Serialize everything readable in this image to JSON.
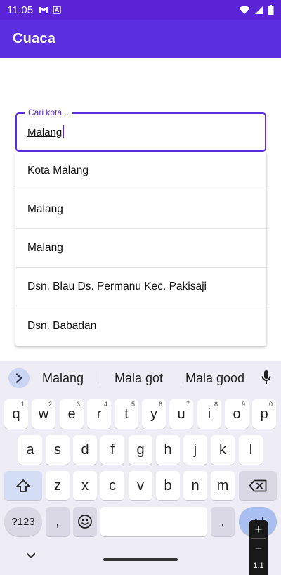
{
  "status_bar": {
    "time": "11:05"
  },
  "app": {
    "title": "Cuaca"
  },
  "search": {
    "label": "Cari kota...",
    "value": "Malang"
  },
  "suggestions": [
    "Kota Malang",
    "Malang",
    "Malang",
    "Dsn. Blau Ds. Permanu Kec. Pakisaji",
    "Dsn. Babadan"
  ],
  "keyboard": {
    "word_suggestions": [
      "Malang",
      "Mala got",
      "Mala good"
    ],
    "row1": [
      {
        "k": "q",
        "h": "1"
      },
      {
        "k": "w",
        "h": "2"
      },
      {
        "k": "e",
        "h": "3"
      },
      {
        "k": "r",
        "h": "4"
      },
      {
        "k": "t",
        "h": "5"
      },
      {
        "k": "y",
        "h": "6"
      },
      {
        "k": "u",
        "h": "7"
      },
      {
        "k": "i",
        "h": "8"
      },
      {
        "k": "o",
        "h": "9"
      },
      {
        "k": "p",
        "h": "0"
      }
    ],
    "row2": [
      "a",
      "s",
      "d",
      "f",
      "g",
      "h",
      "j",
      "k",
      "l"
    ],
    "row3": [
      "z",
      "x",
      "c",
      "v",
      "b",
      "n",
      "m"
    ],
    "symbols_label": "?123",
    "comma": ",",
    "period": "."
  },
  "zoom": {
    "plus": "+",
    "minus": "−",
    "ratio": "1:1"
  },
  "colors": {
    "primary": "#5b2ee0",
    "status_bar": "#5a24d6",
    "keyboard_bg": "#eeecf4"
  }
}
